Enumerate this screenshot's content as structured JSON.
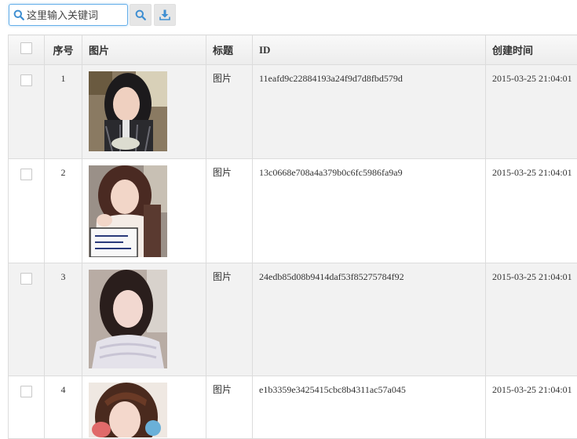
{
  "toolbar": {
    "search_placeholder": "这里输入关键词",
    "search_icon": "search-icon",
    "download_icon": "download-icon"
  },
  "table": {
    "headers": {
      "no": "序号",
      "image": "图片",
      "title": "标题",
      "id": "ID",
      "created": "创建时间"
    },
    "rows": [
      {
        "no": "1",
        "title": "图片",
        "id": "11eafd9c22884193a24f9d7d8fbd579d",
        "created": "2015-03-25 21:04:01",
        "photo": "portrait-1"
      },
      {
        "no": "2",
        "title": "图片",
        "id": "13c0668e708a4a379b0c6fc5986fa9a9",
        "created": "2015-03-25 21:04:01",
        "photo": "portrait-2"
      },
      {
        "no": "3",
        "title": "图片",
        "id": "24edb85d08b9414daf53f85275784f92",
        "created": "2015-03-25 21:04:01",
        "photo": "portrait-3"
      },
      {
        "no": "4",
        "title": "图片",
        "id": "e1b3359e3425415cbc8b4311ac57a045",
        "created": "2015-03-25 21:04:01",
        "photo": "portrait-4"
      }
    ]
  },
  "colors": {
    "accent": "#66afe9",
    "icon_blue": "#3f8fd2",
    "row_alt": "#f2f2f2",
    "border": "#dcdcdc"
  }
}
